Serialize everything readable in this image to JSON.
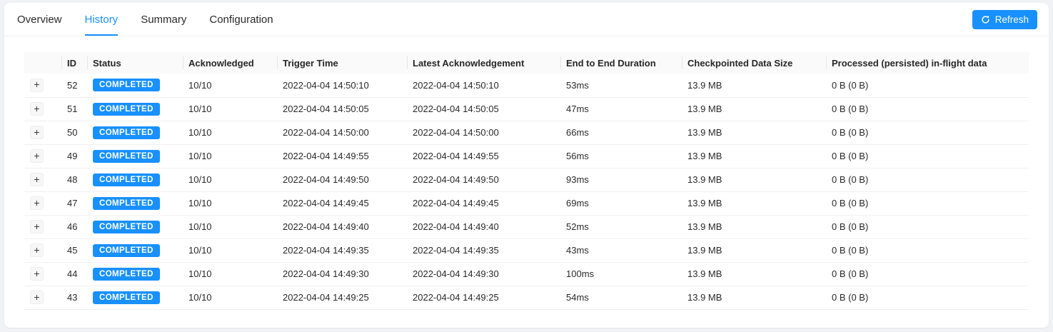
{
  "tabs": [
    {
      "label": "Overview",
      "active": false
    },
    {
      "label": "History",
      "active": true
    },
    {
      "label": "Summary",
      "active": false
    },
    {
      "label": "Configuration",
      "active": false
    }
  ],
  "refresh_button": {
    "label": "Refresh",
    "icon": "sync-icon"
  },
  "colors": {
    "accent": "#1890ff",
    "badge": "#1890ff",
    "header_bg": "#fafafa",
    "row_border": "#f0f0f0",
    "page_bg": "#f0f2f5"
  },
  "table": {
    "expand_icon": "+",
    "columns": [
      "",
      "ID",
      "Status",
      "Acknowledged",
      "Trigger Time",
      "Latest Acknowledgement",
      "End to End Duration",
      "Checkpointed Data Size",
      "Processed (persisted) in-flight data"
    ],
    "rows": [
      {
        "id": "52",
        "status": "COMPLETED",
        "acknowledged": "10/10",
        "trigger_time": "2022-04-04 14:50:10",
        "latest_acknowledgement": "2022-04-04 14:50:10",
        "end_to_end_duration": "53ms",
        "checkpointed_data_size": "13.9 MB",
        "processed_in_flight": "0 B (0 B)"
      },
      {
        "id": "51",
        "status": "COMPLETED",
        "acknowledged": "10/10",
        "trigger_time": "2022-04-04 14:50:05",
        "latest_acknowledgement": "2022-04-04 14:50:05",
        "end_to_end_duration": "47ms",
        "checkpointed_data_size": "13.9 MB",
        "processed_in_flight": "0 B (0 B)"
      },
      {
        "id": "50",
        "status": "COMPLETED",
        "acknowledged": "10/10",
        "trigger_time": "2022-04-04 14:50:00",
        "latest_acknowledgement": "2022-04-04 14:50:00",
        "end_to_end_duration": "66ms",
        "checkpointed_data_size": "13.9 MB",
        "processed_in_flight": "0 B (0 B)"
      },
      {
        "id": "49",
        "status": "COMPLETED",
        "acknowledged": "10/10",
        "trigger_time": "2022-04-04 14:49:55",
        "latest_acknowledgement": "2022-04-04 14:49:55",
        "end_to_end_duration": "56ms",
        "checkpointed_data_size": "13.9 MB",
        "processed_in_flight": "0 B (0 B)"
      },
      {
        "id": "48",
        "status": "COMPLETED",
        "acknowledged": "10/10",
        "trigger_time": "2022-04-04 14:49:50",
        "latest_acknowledgement": "2022-04-04 14:49:50",
        "end_to_end_duration": "93ms",
        "checkpointed_data_size": "13.9 MB",
        "processed_in_flight": "0 B (0 B)"
      },
      {
        "id": "47",
        "status": "COMPLETED",
        "acknowledged": "10/10",
        "trigger_time": "2022-04-04 14:49:45",
        "latest_acknowledgement": "2022-04-04 14:49:45",
        "end_to_end_duration": "69ms",
        "checkpointed_data_size": "13.9 MB",
        "processed_in_flight": "0 B (0 B)"
      },
      {
        "id": "46",
        "status": "COMPLETED",
        "acknowledged": "10/10",
        "trigger_time": "2022-04-04 14:49:40",
        "latest_acknowledgement": "2022-04-04 14:49:40",
        "end_to_end_duration": "52ms",
        "checkpointed_data_size": "13.9 MB",
        "processed_in_flight": "0 B (0 B)"
      },
      {
        "id": "45",
        "status": "COMPLETED",
        "acknowledged": "10/10",
        "trigger_time": "2022-04-04 14:49:35",
        "latest_acknowledgement": "2022-04-04 14:49:35",
        "end_to_end_duration": "43ms",
        "checkpointed_data_size": "13.9 MB",
        "processed_in_flight": "0 B (0 B)"
      },
      {
        "id": "44",
        "status": "COMPLETED",
        "acknowledged": "10/10",
        "trigger_time": "2022-04-04 14:49:30",
        "latest_acknowledgement": "2022-04-04 14:49:30",
        "end_to_end_duration": "100ms",
        "checkpointed_data_size": "13.9 MB",
        "processed_in_flight": "0 B (0 B)"
      },
      {
        "id": "43",
        "status": "COMPLETED",
        "acknowledged": "10/10",
        "trigger_time": "2022-04-04 14:49:25",
        "latest_acknowledgement": "2022-04-04 14:49:25",
        "end_to_end_duration": "54ms",
        "checkpointed_data_size": "13.9 MB",
        "processed_in_flight": "0 B (0 B)"
      }
    ]
  }
}
